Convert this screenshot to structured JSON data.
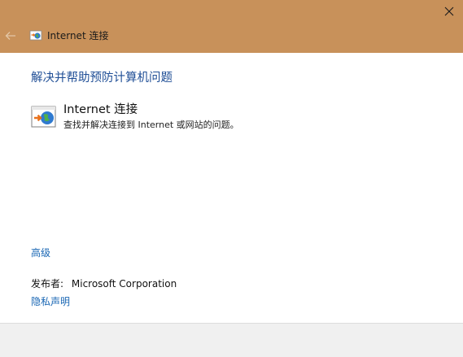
{
  "window": {
    "title": "Internet 连接",
    "titlebar_color": "#c8915a",
    "close_icon": "close-icon",
    "back_icon": "back-arrow-icon"
  },
  "main": {
    "heading": "解决并帮助预防计算机问题",
    "troubleshooter": {
      "title": "Internet 连接",
      "description": "查找并解决连接到 Internet 或网站的问题。",
      "icon": "internet-connection-icon"
    },
    "advanced_link": "高级",
    "publisher_label": "发布者:",
    "publisher_name": "Microsoft Corporation",
    "privacy_link": "隐私声明"
  },
  "colors": {
    "link": "#1a67b4",
    "heading": "#1f4e96",
    "footer": "#f0f0f0"
  }
}
